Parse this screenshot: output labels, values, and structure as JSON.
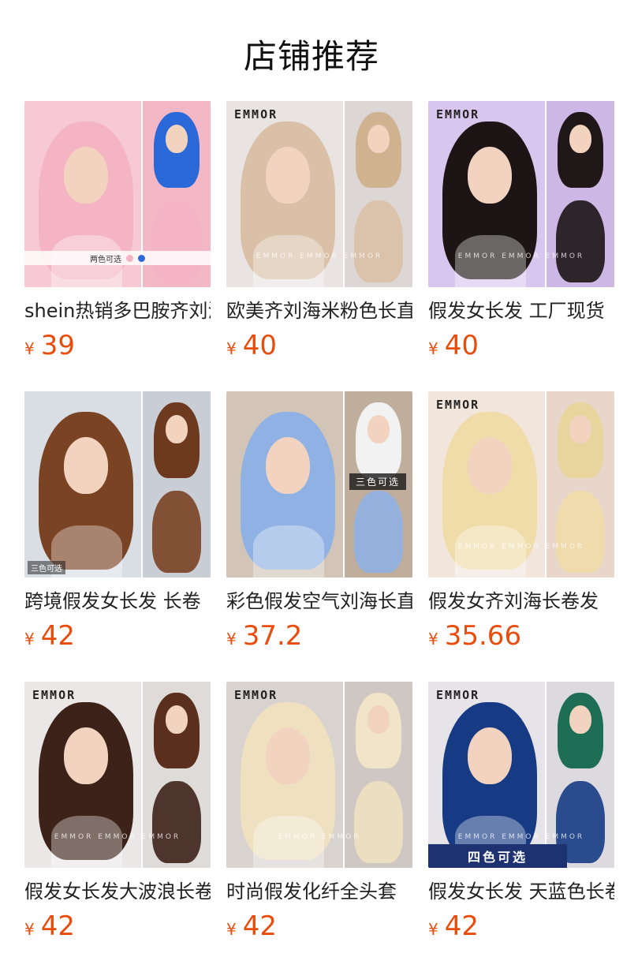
{
  "page_title": "店铺推荐",
  "products": [
    {
      "name": "shein热销多巴胺齐刘海",
      "price": "39",
      "currency": "¥",
      "brand_text": "",
      "badge": "两色可选",
      "badge_style": "strip",
      "bg": [
        "#f7c9d4",
        "#f4b7c6"
      ],
      "hair": [
        "#f4b4c4",
        "#2b68d8"
      ],
      "watermark": ""
    },
    {
      "name": "欧美齐刘海米粉色长直",
      "price": "40",
      "currency": "¥",
      "brand_text": "EMMOR",
      "badge": "",
      "badge_style": "",
      "bg": [
        "#e9e4e2",
        "#dcd6d4"
      ],
      "hair": [
        "#d9c0a6",
        "#cfb28f"
      ],
      "watermark": "EMMOR  EMMOR  EMMOR"
    },
    {
      "name": "假发女长发 工厂现货",
      "price": "40",
      "currency": "¥",
      "brand_text": "EMMOR",
      "badge": "",
      "badge_style": "",
      "bg": [
        "#d9c6ef",
        "#cdb7e4"
      ],
      "hair": [
        "#1d1515",
        "#201818"
      ],
      "watermark": "EMMOR  EMMOR  EMMOR"
    },
    {
      "name": "跨境假发女长发 长卷",
      "price": "42",
      "currency": "¥",
      "brand_text": "",
      "badge": "三色可选",
      "badge_style": "small",
      "bg": [
        "#d9dde4",
        "#c9ced6"
      ],
      "hair": [
        "#7a4324",
        "#6d3a1f"
      ],
      "watermark": ""
    },
    {
      "name": "彩色假发空气刘海长直",
      "price": "37.2",
      "currency": "¥",
      "brand_text": "",
      "badge": "三色可选",
      "badge_style": "mid",
      "bg": [
        "#d2c4b6",
        "#c0ae9c"
      ],
      "hair": [
        "#8fb1e4",
        "#f2f2f2"
      ],
      "watermark": ""
    },
    {
      "name": "假发女齐刘海长卷发",
      "price": "35.66",
      "currency": "¥",
      "brand_text": "EMMOR",
      "badge": "",
      "badge_style": "",
      "bg": [
        "#f1e5dc",
        "#e8d6cb"
      ],
      "hair": [
        "#efdca8",
        "#e8d59e"
      ],
      "watermark": "EMMOR  EMMOR  EMMOR"
    },
    {
      "name": "假发女长发大波浪长卷",
      "price": "42",
      "currency": "¥",
      "brand_text": "EMMOR",
      "badge": "",
      "badge_style": "",
      "bg": [
        "#eae7e6",
        "#dfdbd9"
      ],
      "hair": [
        "#3d2219",
        "#5b2f1e"
      ],
      "watermark": "EMMOR  EMMOR  EMMOR"
    },
    {
      "name": "时尚假发化纤全头套",
      "price": "42",
      "currency": "¥",
      "brand_text": "EMMOR",
      "badge": "",
      "badge_style": "",
      "bg": [
        "#d9d3cf",
        "#cec7c3"
      ],
      "hair": [
        "#efe0c0",
        "#f1e4c8"
      ],
      "watermark": "EMMOR  EMMOR"
    },
    {
      "name": "假发女长发 天蓝色长卷",
      "price": "42",
      "currency": "¥",
      "brand_text": "EMMOR",
      "badge": "四色可选",
      "badge_style": "bar",
      "bg": [
        "#e6e4e8",
        "#dcdade"
      ],
      "hair": [
        "#163b84",
        "#1d6e55"
      ],
      "watermark": "EMMOR  EMMOR  EMMOR"
    }
  ]
}
